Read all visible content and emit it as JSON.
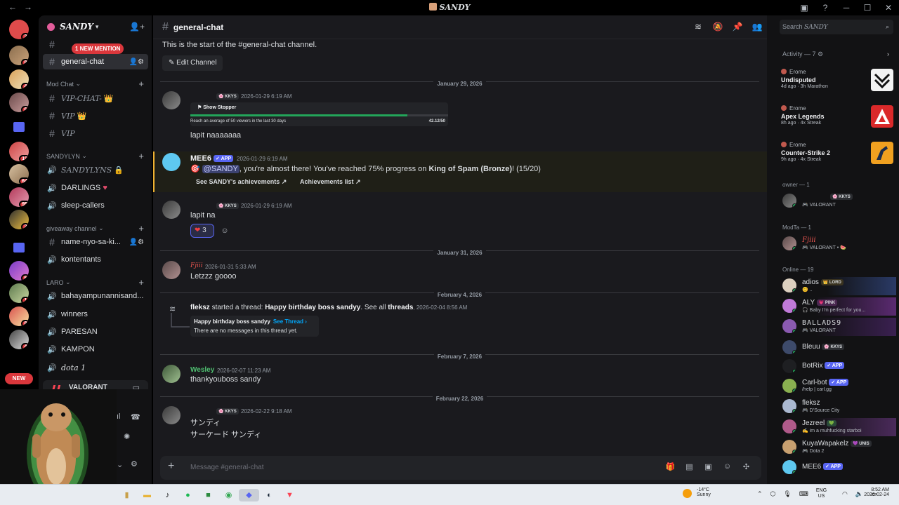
{
  "window": {
    "title": "SANDY",
    "back": "←",
    "forward": "→"
  },
  "guilds": {
    "badges": [
      "3",
      "8",
      "4",
      "6",
      "19",
      "64",
      "95",
      "2",
      "6",
      "1",
      "8",
      "4"
    ],
    "new_label": "NEW"
  },
  "server": {
    "name": "SANDY",
    "mention_pill": "1 NEW MENTION"
  },
  "channels": {
    "top": [
      {
        "name": "general-chat"
      }
    ],
    "mod_chat": {
      "label": "Mod Chat",
      "items": [
        "VIP-CHAT-",
        "VIP",
        "VIP"
      ]
    },
    "sandylyn": {
      "label": "SANDYLYN",
      "items": [
        "SANDYLYNS",
        "DARLINGS",
        "sleep-callers"
      ]
    },
    "giveaway": {
      "label": "giveaway channel",
      "items": [
        "name-nyo-sa-ki...",
        "kontentants"
      ]
    },
    "laro": {
      "label": "LARO",
      "items": [
        "bahayampunannisand...",
        "winners",
        "PARESAN",
        "KAMPON",
        "dota 1"
      ]
    }
  },
  "voice": {
    "label": "VALORANT"
  },
  "channel_header": {
    "name": "general-chat"
  },
  "messages": {
    "start_text": "This is the start of the #general-chat channel.",
    "edit_channel": "Edit Channel",
    "dates": [
      "January 29, 2026",
      "January 31, 2026",
      "February 4, 2026",
      "February 7, 2026",
      "February 22, 2026"
    ],
    "m1": {
      "tag": "KKYS",
      "time": "2026-01-29 6:19 AM",
      "embed_title": "Show Stopper",
      "embed_desc": "Reach an average of 50 viewers in the last 30 days",
      "embed_value": "42.12/50",
      "progress": 0.8424,
      "text": "lapit naaaaaaa"
    },
    "m2": {
      "author": "MEE6",
      "app": "APP",
      "time": "2026-01-29 6:19 AM",
      "mention": "@SANDY",
      "text_a": ", you're almost there! You've reached 75% progress on ",
      "bold": "King of Spam (Bronze)",
      "text_b": "! (15/20)",
      "btn1": "See SANDY's achievements",
      "btn2": "Achievements list"
    },
    "m3": {
      "tag": "KKYS",
      "time": "2026-01-29 6:19 AM",
      "text": "lapit na",
      "reaction_count": "3"
    },
    "m4": {
      "author": "Fjiii",
      "time": "2026-01-31 5:33 AM",
      "text": "Letzzz goooo"
    },
    "m5": {
      "author": "fleksz",
      "started": "started a thread:",
      "thread": "Happy birthday boss sandyy",
      "see_all": ". See all",
      "threads": "threads",
      "time": "2026-02-04 8:56 AM",
      "card_title": "Happy birthday boss sandyy",
      "see_thread": "See Thread ›",
      "card_sub": "There are no messages in this thread yet."
    },
    "m6": {
      "author": "Wesley",
      "time": "2026-02-07 11:23 AM",
      "text": "thankyouboss sandy"
    },
    "m7": {
      "tag": "KKYS",
      "time": "2026-02-22 9:18 AM",
      "line1": "サンディ",
      "line2": "サーケード サンディ"
    }
  },
  "composer": {
    "placeholder": "Message #general-chat"
  },
  "right": {
    "search_placeholder": "Search",
    "search_server": "SANDY",
    "activity_title": "Activity — 7",
    "activities": [
      {
        "who": "Erome",
        "game": "Undisputed",
        "meta": "4d ago · 3h Marathon"
      },
      {
        "who": "Erome",
        "game": "Apex Legends",
        "meta": "8h ago · 4x Streak"
      },
      {
        "who": "Erome",
        "game": "Counter-Strike 2",
        "meta": "9h ago · 4x Streak"
      }
    ],
    "owner_title": "owner — 1",
    "owner": {
      "tag": "KKYS",
      "status": "VALORANT"
    },
    "modta_title": "ModTa — 1",
    "modta": {
      "name": "Fjiii",
      "status": "VALORANT •"
    },
    "online_title": "Online — 19",
    "members": [
      {
        "name": "adios",
        "tag": "LORD",
        "status": ""
      },
      {
        "name": "ALY",
        "tag": "PINK",
        "status": "Baby I'm perfect for you..."
      },
      {
        "name": "BALLADS9",
        "tag": "",
        "status": "VALORANT"
      },
      {
        "name": "Bleuu",
        "tag": "KKYS",
        "status": ""
      },
      {
        "name": "BotRix",
        "tag": "APP",
        "status": ""
      },
      {
        "name": "Carl-bot",
        "tag": "APP",
        "status": "/help | carl.gg"
      },
      {
        "name": "fleksz",
        "tag": "",
        "status": "D'Source City"
      },
      {
        "name": "Jezreel",
        "tag": "",
        "status": "im a muhfucking starboi"
      },
      {
        "name": "KuyaWapakelz",
        "tag": "UNIS",
        "status": "Dota 2"
      },
      {
        "name": "MEE6",
        "tag": "APP",
        "status": ""
      }
    ]
  },
  "taskbar": {
    "temp": "-14°C",
    "weather": "Sunny",
    "lang1": "ENG",
    "lang2": "US",
    "time": "8:52 AM",
    "date": "2026-02-24"
  }
}
